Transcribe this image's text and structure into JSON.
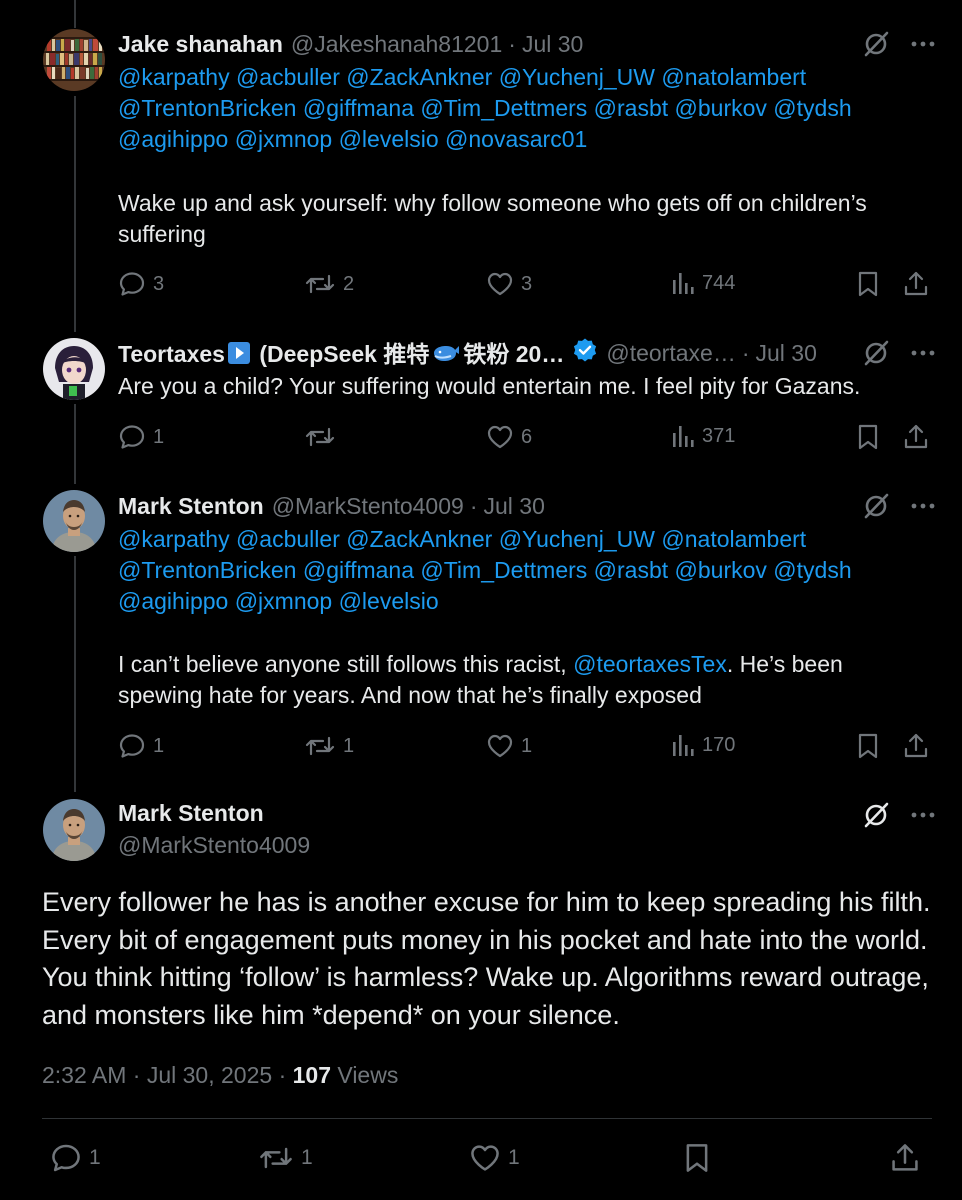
{
  "reply1": {
    "name": "Jake shanahan",
    "handle": "@Jakeshanah81201",
    "date": "Jul 30",
    "mention_lines": [
      "@karpathy  @acbuller @ZackAnkner @Yuchenj_UW @natolambert",
      "@TrentonBricken @giffmana @Tim_Dettmers @rasbt @burkov @tydsh",
      "@agihippo @jxmnop @levelsio @novasarc01"
    ],
    "body": "Wake up and ask yourself: why follow someone who gets off on children’s suffering",
    "replies": "3",
    "reposts": "2",
    "likes": "3",
    "views": "744"
  },
  "reply2": {
    "name_part1": "Teortaxes",
    "name_part2": " (DeepSeek 推特",
    "name_part3": "铁粉 20…",
    "handle": "@teortaxe…",
    "date": "Jul 30",
    "body": "Are you a child? Your suffering would entertain me. I feel pity for Gazans.",
    "replies": "1",
    "reposts": "",
    "likes": "6",
    "views": "371",
    "verified_color": "#1d9bf0"
  },
  "reply3": {
    "name": "Mark Stenton",
    "handle": "@MarkStento4009",
    "date": "Jul 30",
    "mention_lines": [
      "@karpathy @acbuller @ZackAnkner @Yuchenj_UW @natolambert",
      "@TrentonBricken @giffmana @Tim_Dettmers @rasbt @burkov @tydsh",
      "@agihippo @jxmnop @levelsio"
    ],
    "body_line1_a": "I can’t believe anyone still follows this racist, ",
    "body_line1_mention": "@teortaxesTex",
    "body_line1_b": ". He’s been",
    "body_line2": "spewing hate for years. And now that he’s finally exposed",
    "replies": "1",
    "reposts": "1",
    "likes": "1",
    "views": "170"
  },
  "main": {
    "name": "Mark Stenton",
    "handle": "@MarkStento4009",
    "body": "Every follower he has is another excuse for him to keep spreading his filth. Every bit of engagement puts money in his pocket and hate into the world. You think hitting ‘follow’ is harmless? Wake up. Algorithms reward outrage, and monsters like him *depend* on your silence.",
    "time": "2:32 AM",
    "date": "Jul 30, 2025",
    "views_count": "107",
    "views_label": "Views",
    "replies": "1",
    "reposts": "1",
    "likes": "1"
  },
  "colors": {
    "background": "#000000",
    "text": "#e7e9ea",
    "muted": "#71767b",
    "link": "#1d9bf0",
    "divider": "#2f3336"
  },
  "icons": [
    "reply-icon",
    "repost-icon",
    "like-icon",
    "views-icon",
    "bookmark-icon",
    "share-icon",
    "grok-icon",
    "more-icon",
    "verified-badge-icon",
    "play-emoji-icon",
    "whale-emoji-icon"
  ]
}
